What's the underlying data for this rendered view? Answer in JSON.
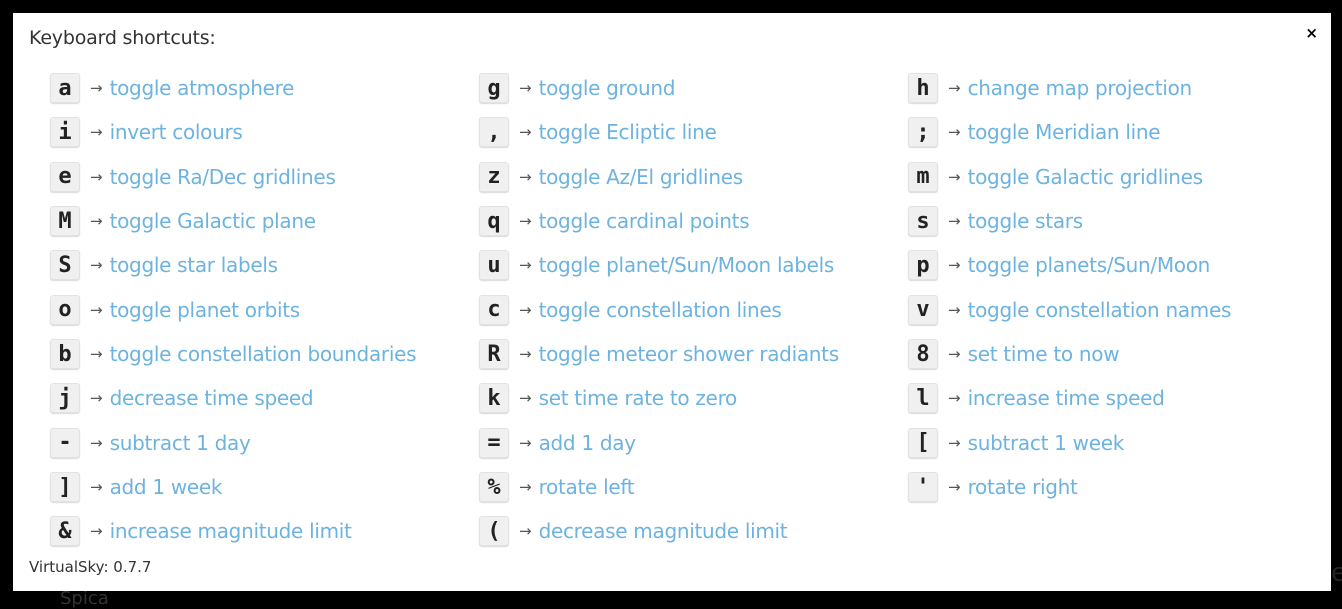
{
  "dialog": {
    "title": "Keyboard shortcuts:",
    "close_symbol": "×",
    "arrow": "→",
    "version": "VirtualSky: 0.7.7"
  },
  "background": {
    "label": "Spica",
    "edge_char": "e"
  },
  "shortcuts": [
    {
      "key": "a",
      "action": "toggle atmosphere"
    },
    {
      "key": "g",
      "action": "toggle ground"
    },
    {
      "key": "h",
      "action": "change map projection"
    },
    {
      "key": "i",
      "action": "invert colours"
    },
    {
      "key": ",",
      "action": "toggle Ecliptic line"
    },
    {
      "key": ";",
      "action": "toggle Meridian line"
    },
    {
      "key": "e",
      "action": "toggle Ra/Dec gridlines"
    },
    {
      "key": "z",
      "action": "toggle Az/El gridlines"
    },
    {
      "key": "m",
      "action": "toggle Galactic gridlines"
    },
    {
      "key": "M",
      "action": "toggle Galactic plane"
    },
    {
      "key": "q",
      "action": "toggle cardinal points"
    },
    {
      "key": "s",
      "action": "toggle stars"
    },
    {
      "key": "S",
      "action": "toggle star labels"
    },
    {
      "key": "u",
      "action": "toggle planet/Sun/Moon labels"
    },
    {
      "key": "p",
      "action": "toggle planets/Sun/Moon"
    },
    {
      "key": "o",
      "action": "toggle planet orbits"
    },
    {
      "key": "c",
      "action": "toggle constellation lines"
    },
    {
      "key": "v",
      "action": "toggle constellation names"
    },
    {
      "key": "b",
      "action": "toggle constellation boundaries"
    },
    {
      "key": "R",
      "action": "toggle meteor shower radiants"
    },
    {
      "key": "8",
      "action": "set time to now"
    },
    {
      "key": "j",
      "action": "decrease time speed"
    },
    {
      "key": "k",
      "action": "set time rate to zero"
    },
    {
      "key": "l",
      "action": "increase time speed"
    },
    {
      "key": "-",
      "action": "subtract 1 day"
    },
    {
      "key": "=",
      "action": "add 1 day"
    },
    {
      "key": "[",
      "action": "subtract 1 week"
    },
    {
      "key": "]",
      "action": "add 1 week"
    },
    {
      "key": "%",
      "action": "rotate left"
    },
    {
      "key": "'",
      "action": "rotate right"
    },
    {
      "key": "&",
      "action": "increase magnitude limit"
    },
    {
      "key": "(",
      "action": "decrease magnitude limit"
    }
  ]
}
